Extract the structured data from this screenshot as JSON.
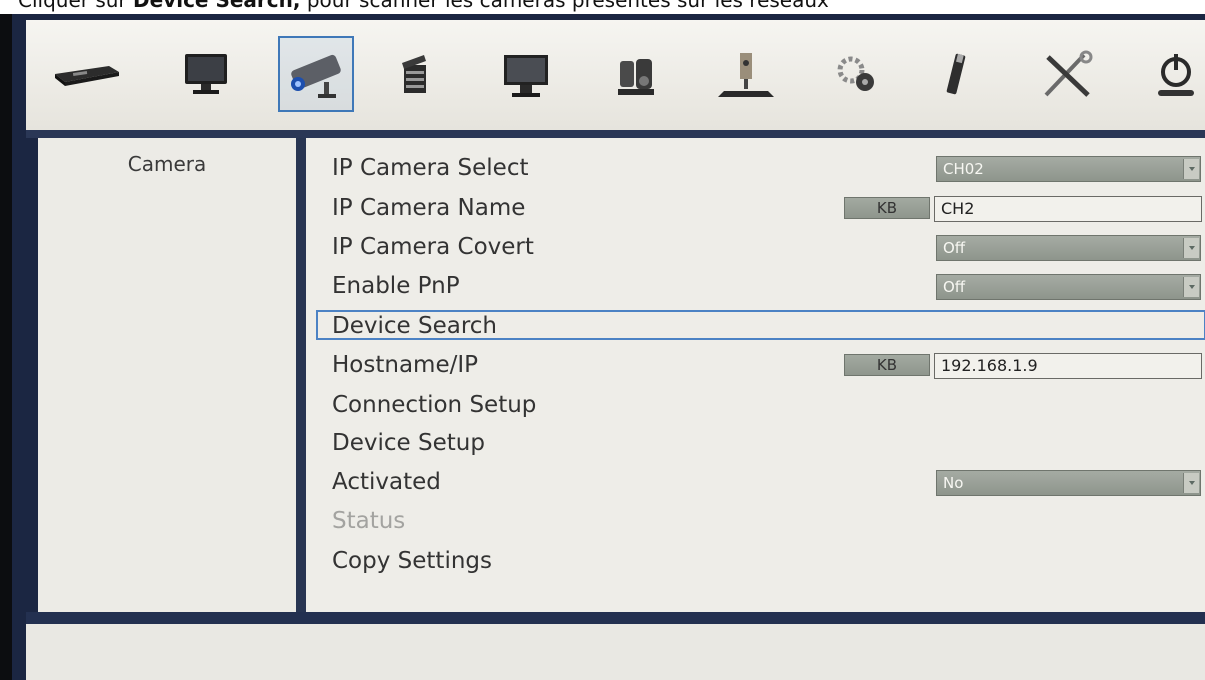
{
  "caption": {
    "before": "Cliquer sur ",
    "bold": "Device Search,",
    "after": " pour scanner les caméras présentes sur les réseaux"
  },
  "toolbar": {
    "icons": [
      "dvr-icon",
      "monitor-icon",
      "camera-icon",
      "record-icon",
      "display-icon",
      "ptz-icon",
      "network-icon",
      "settings-icon",
      "usb-icon",
      "tools-icon",
      "power-icon"
    ],
    "selected": "camera-icon"
  },
  "sidebar": {
    "title": "Camera"
  },
  "settings": {
    "ip_camera_select": {
      "label": "IP Camera Select",
      "value": "CH02"
    },
    "ip_camera_name": {
      "label": "IP Camera Name",
      "kb": "KB",
      "value": "CH2"
    },
    "ip_camera_covert": {
      "label": "IP Camera Covert",
      "value": "Off"
    },
    "enable_pnp": {
      "label": "Enable PnP",
      "value": "Off"
    },
    "device_search": {
      "label": "Device Search"
    },
    "hostname_ip": {
      "label": "Hostname/IP",
      "kb": "KB",
      "value": "192.168.1.9"
    },
    "connection_setup": {
      "label": "Connection Setup"
    },
    "device_setup": {
      "label": "Device Setup"
    },
    "activated": {
      "label": "Activated",
      "value": "No"
    },
    "status": {
      "label": "Status"
    },
    "copy_settings": {
      "label": "Copy Settings"
    }
  }
}
